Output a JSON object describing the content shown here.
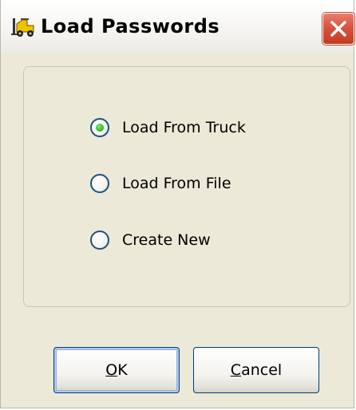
{
  "window": {
    "title": "Load Passwords",
    "icon": "forklift-icon",
    "close_icon": "close-icon"
  },
  "options": [
    {
      "label": "Load From Truck",
      "selected": true
    },
    {
      "label": "Load From File",
      "selected": false
    },
    {
      "label": "Create New",
      "selected": false
    }
  ],
  "buttons": {
    "ok": {
      "mnemonic": "O",
      "rest": "K"
    },
    "cancel": {
      "mnemonic": "C",
      "rest": "ancel"
    }
  },
  "colors": {
    "dialog_background": "#ece9d8",
    "close_button": "#d9553f",
    "radio_selected_dot": "#2fbf30",
    "button_border": "#003c74"
  }
}
